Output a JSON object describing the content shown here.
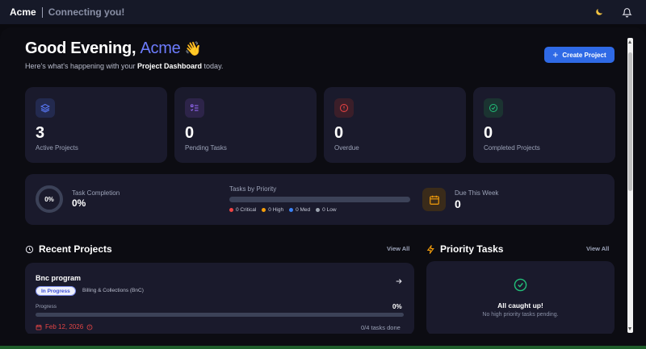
{
  "topbar": {
    "brand": "Acme",
    "tagline": "Connecting you!",
    "theme_icon": "moon-icon",
    "notif_icon": "bell-icon"
  },
  "header": {
    "greeting": "Good Evening,",
    "name": "Acme",
    "wave": "👋",
    "subtitle_pre": "Here's what's happening with your ",
    "subtitle_bold": "Project Dashboard",
    "subtitle_post": " today.",
    "create_button": "Create Project"
  },
  "stats": [
    {
      "value": "3",
      "label": "Active Projects",
      "icon": "layers-icon",
      "color": "#5b7cff",
      "bg": "#232a4f"
    },
    {
      "value": "0",
      "label": "Pending Tasks",
      "icon": "list-check-icon",
      "color": "#9b6cff",
      "bg": "#2d2449"
    },
    {
      "value": "0",
      "label": "Overdue",
      "icon": "alert-circle-icon",
      "color": "#ef4444",
      "bg": "#3b1e29"
    },
    {
      "value": "0",
      "label": "Completed Projects",
      "icon": "check-circle-icon",
      "color": "#22c07a",
      "bg": "#1b3331"
    }
  ],
  "summary": {
    "completion_pct": "0%",
    "completion_label": "Task Completion",
    "completion_value": "0%",
    "completion_fraction": 0,
    "priority_label": "Tasks by Priority",
    "legend": [
      {
        "label": "0 Critical",
        "color": "#ef4444"
      },
      {
        "label": "0 High",
        "color": "#f59e0b"
      },
      {
        "label": "0 Med",
        "color": "#3b82f6"
      },
      {
        "label": "0 Low",
        "color": "#9ca3af"
      }
    ],
    "due_label": "Due This Week",
    "due_value": "0"
  },
  "recent_projects": {
    "title": "Recent Projects",
    "view_all": "View All",
    "items": [
      {
        "name": "Bnc program",
        "status": "In Progress",
        "client": "Billing & Collections (BnC)",
        "progress_label": "Progress",
        "progress_pct": "0%",
        "progress_fraction": 0,
        "due_date": "Feb 12, 2026",
        "tasks_done": "0/4 tasks done"
      }
    ]
  },
  "priority_tasks": {
    "title": "Priority Tasks",
    "view_all": "View All",
    "empty_title": "All caught up!",
    "empty_sub": "No high priority tasks pending."
  }
}
